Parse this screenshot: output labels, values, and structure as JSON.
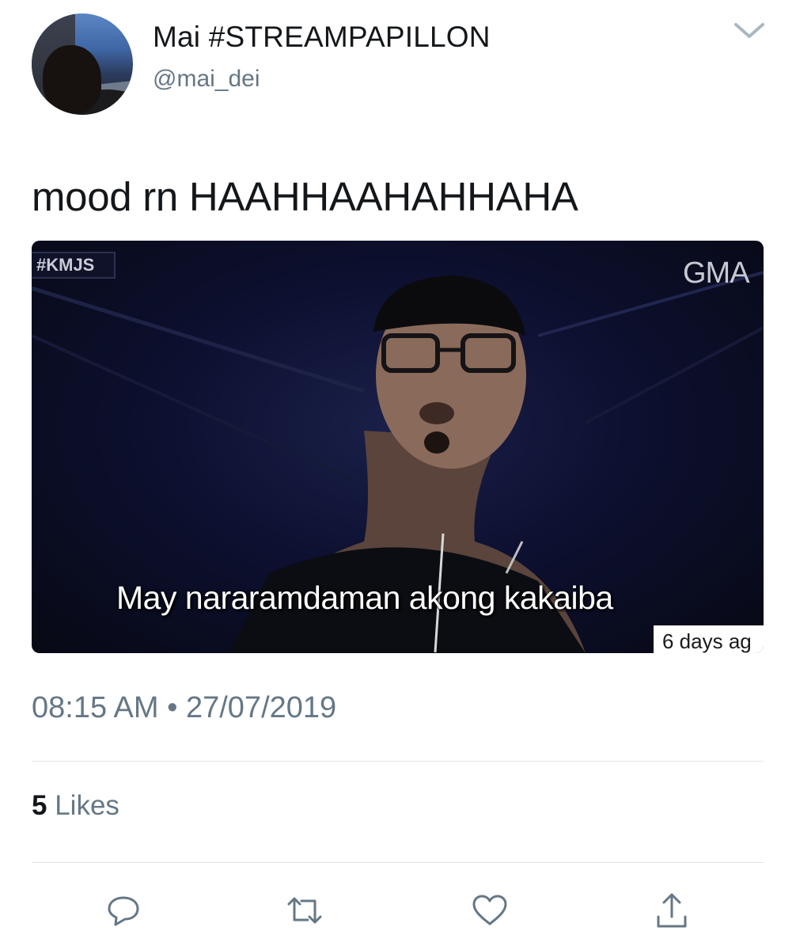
{
  "tweet": {
    "display_name": "Mai #STREAMPAPILLON",
    "handle": "@mai_dei",
    "text": "mood rn HAAHHAAHAHHAHA",
    "timestamp": "08:15 AM • 27/07/2019",
    "likes_count": "5",
    "likes_label": "Likes"
  },
  "media": {
    "tag": "#KMJS",
    "channel": "GMA",
    "caption": "May nararamdaman akong kakaiba",
    "age": "6 days ag"
  },
  "actions": [
    {
      "icon": "reply-icon"
    },
    {
      "icon": "retweet-icon"
    },
    {
      "icon": "like-heart-icon"
    },
    {
      "icon": "share-icon"
    }
  ],
  "colors": {
    "text_primary": "#14171a",
    "text_secondary": "#657786",
    "divider": "#dfe3e8",
    "icon": "#657786"
  }
}
